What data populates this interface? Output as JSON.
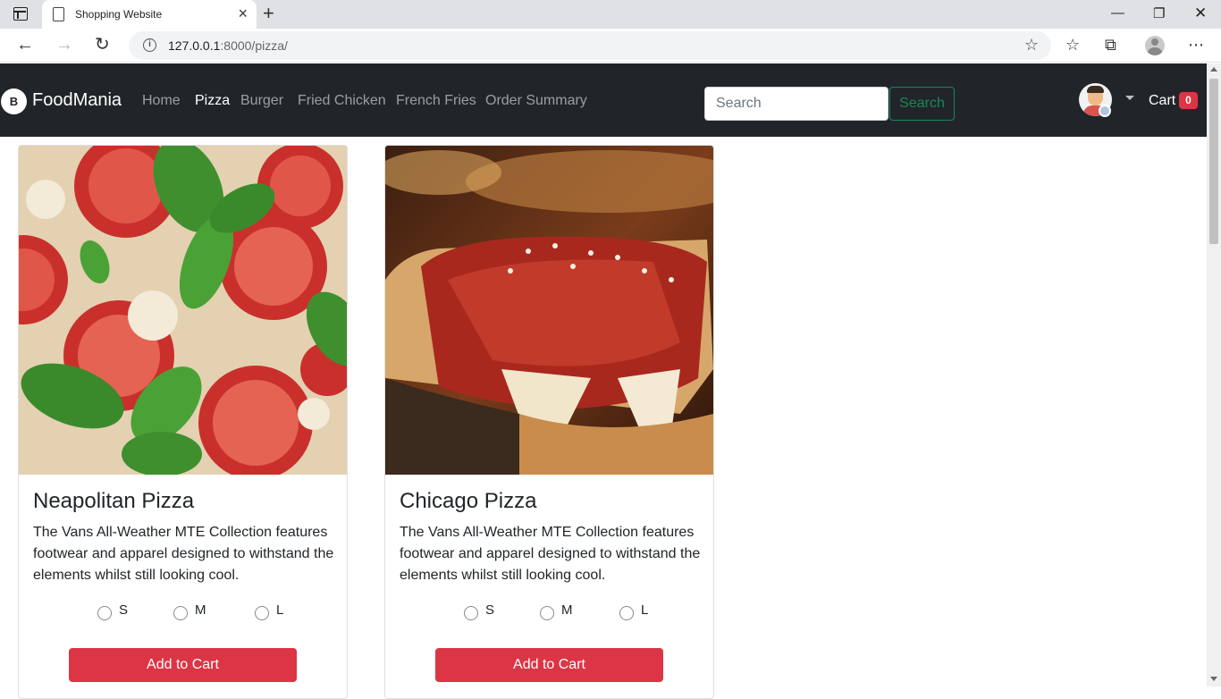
{
  "browser": {
    "tab_title": "Shopping Website",
    "url_host": "127.0.0.1",
    "url_rest": ":8000/pizza/"
  },
  "navbar": {
    "brand_logo": "B",
    "brand": "FoodMania",
    "links": [
      "Home",
      "Pizza",
      "Burger",
      "Fried Chicken",
      "French Fries",
      "Order Summary"
    ],
    "active_link": "Pizza",
    "search_placeholder": "Search",
    "search_button": "Search",
    "cart_label": "Cart",
    "cart_count": "0"
  },
  "products": [
    {
      "name": "Neapolitan Pizza",
      "description": "The Vans All-Weather MTE Collection features footwear and apparel designed to withstand the elements whilst still looking cool.",
      "sizes": [
        "S",
        "M",
        "L"
      ],
      "button": "Add to Cart",
      "image": "tomato-basil-pizza"
    },
    {
      "name": "Chicago Pizza",
      "description": "The Vans All-Weather MTE Collection features footwear and apparel designed to withstand the elements whilst still looking cool.",
      "sizes": [
        "S",
        "M",
        "L"
      ],
      "button": "Add to Cart",
      "image": "deep-dish-pizza"
    }
  ],
  "colors": {
    "navbar_bg": "#212529",
    "accent_red": "#dc3545",
    "search_green": "#198754"
  }
}
